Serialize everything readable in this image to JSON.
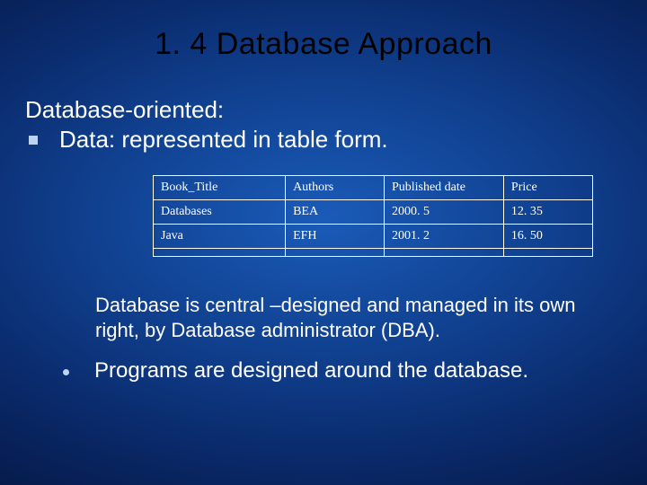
{
  "title": "1. 4 Database Approach",
  "subtitle1": "Database-oriented:",
  "subtitle2": "Data: represented in table form.",
  "table": {
    "headers": [
      "Book_Title",
      "Authors",
      "Published date",
      "Price"
    ],
    "rows": [
      [
        "Databases",
        "BEA",
        "2000. 5",
        "12. 35"
      ],
      [
        "Java",
        "EFH",
        "2001. 2",
        "16. 50"
      ]
    ]
  },
  "paragraph": "Database is central –designed and managed in its own right, by Database administrator (DBA).",
  "bullet": "Programs are designed around the database."
}
